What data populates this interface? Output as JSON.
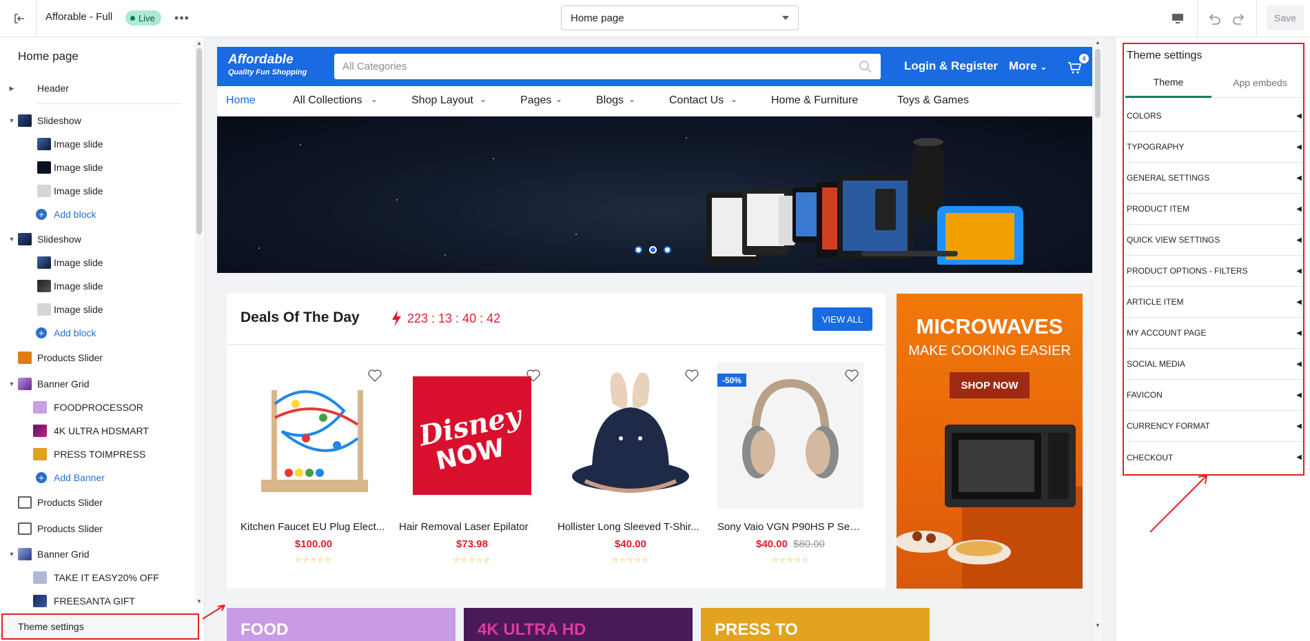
{
  "topbar": {
    "theme_name": "Afforable - Full",
    "live_label": "Live",
    "page_select": "Home page",
    "save_label": "Save"
  },
  "sidebar": {
    "title": "Home page",
    "header_label": "Header",
    "slideshow1": {
      "label": "Slideshow",
      "slides": [
        "Image slide",
        "Image slide",
        "Image slide"
      ],
      "add": "Add block"
    },
    "slideshow2": {
      "label": "Slideshow",
      "slides": [
        "Image slide",
        "Image slide",
        "Image slide"
      ],
      "add": "Add block"
    },
    "products_slider1": "Products Slider",
    "banner_grid1": {
      "label": "Banner Grid",
      "items": [
        "FOODPROCESSOR",
        "4K ULTRA HDSMART",
        "PRESS TOIMPRESS"
      ],
      "add": "Add Banner"
    },
    "products_slider2": "Products Slider",
    "products_slider3": "Products Slider",
    "banner_grid2": {
      "label": "Banner Grid",
      "items": [
        "TAKE IT EASY20% OFF",
        "FREESANTA GIFT"
      ]
    },
    "theme_settings": "Theme settings"
  },
  "store": {
    "logo_name": "Affordable",
    "logo_tagline": "Quality Fun Shopping",
    "search_placeholder": "All Categories",
    "login": "Login & Register",
    "more": "More",
    "cart_count": "4",
    "nav": [
      "Home",
      "All Collections",
      "Shop Layout",
      "Pages",
      "Blogs",
      "Contact Us",
      "Home & Furniture",
      "Toys & Games"
    ],
    "deals_title": "Deals Of The Day",
    "deals_timer": "223 : 13 : 40 : 42",
    "view_all": "VIEW ALL",
    "products": [
      {
        "name": "Kitchen Faucet EU Plug Elect...",
        "price": "$100.00",
        "old": ""
      },
      {
        "name": "Hair Removal Laser Epilator",
        "price": "$73.98",
        "old": ""
      },
      {
        "name": "Hollister Long Sleeved T-Shir...",
        "price": "$40.00",
        "old": ""
      },
      {
        "name": "Sony Vaio VGN P90HS P Seri...",
        "price": "$40.00",
        "old": "$80.00",
        "badge": "-50%"
      }
    ],
    "stars": "☆☆☆☆☆",
    "promo": {
      "line1": "MICROWAVES",
      "line2": "MAKE COOKING EASIER",
      "button": "SHOP NOW"
    },
    "banners": [
      "FOOD",
      "4K ULTRA HD",
      "PRESS TO"
    ]
  },
  "theme_panel": {
    "title": "Theme settings",
    "tab_theme": "Theme",
    "tab_embeds": "App embeds",
    "sections": [
      "COLORS",
      "TYPOGRAPHY",
      "GENERAL SETTINGS",
      "PRODUCT ITEM",
      "QUICK VIEW SETTINGS",
      "PRODUCT OPTIONS - FILTERS",
      "ARTICLE ITEM",
      "MY ACCOUNT PAGE",
      "SOCIAL MEDIA",
      "FAVICON",
      "CURRENCY FORMAT",
      "CHECKOUT"
    ]
  },
  "colors": {
    "accent": "#1a6ae2",
    "highlight": "#e02020",
    "live": "#aee9d1"
  }
}
